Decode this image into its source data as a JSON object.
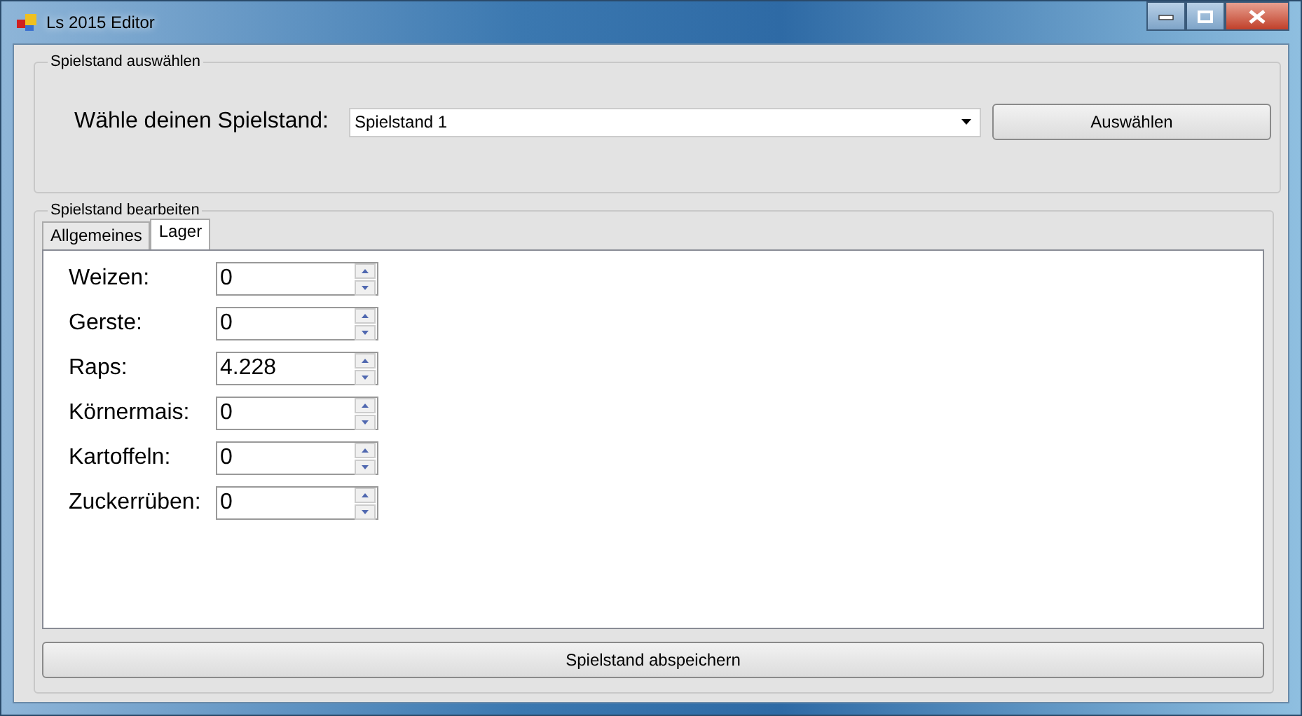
{
  "window": {
    "title": "Ls 2015 Editor"
  },
  "select_group": {
    "title": "Spielstand auswählen",
    "label": "Wähle deinen Spielstand:",
    "dropdown_value": "Spielstand 1",
    "button": "Auswählen"
  },
  "edit_group": {
    "title": "Spielstand bearbeiten",
    "tabs": [
      {
        "label": "Allgemeines",
        "selected": false
      },
      {
        "label": "Lager",
        "selected": true
      }
    ],
    "fields": [
      {
        "label": "Weizen:",
        "value": "0"
      },
      {
        "label": "Gerste:",
        "value": "0"
      },
      {
        "label": "Raps:",
        "value": "4.228"
      },
      {
        "label": "Körnermais:",
        "value": "0"
      },
      {
        "label": "Kartoffeln:",
        "value": "0"
      },
      {
        "label": "Zuckerrüben:",
        "value": "0"
      }
    ],
    "save_button": "Spielstand abspeichern"
  }
}
